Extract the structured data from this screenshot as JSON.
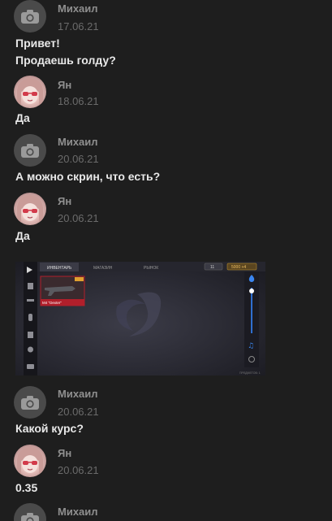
{
  "messages": [
    {
      "author": "Михаил",
      "date": "17.06.21",
      "lines": [
        "Привет!",
        "Продаешь голду?"
      ],
      "avatar": "camera-icon"
    },
    {
      "author": "Ян",
      "date": "18.06.21",
      "lines": [
        "Да"
      ],
      "avatar": "anime-avatar"
    },
    {
      "author": "Михаил",
      "date": "20.06.21",
      "lines": [
        "А можно скрин, что есть?"
      ],
      "avatar": "camera-icon"
    },
    {
      "author": "Ян",
      "date": "20.06.21",
      "lines": [
        "Да"
      ],
      "avatar": "anime-avatar",
      "attachment": "screenshot"
    },
    {
      "author": "Михаил",
      "date": "20.06.21",
      "lines": [
        "Какой курс?"
      ],
      "avatar": "camera-icon"
    },
    {
      "author": "Ян",
      "date": "20.06.21",
      "lines": [
        "0.35"
      ],
      "avatar": "anime-avatar"
    },
    {
      "author": "Михаил",
      "date": "",
      "lines": [],
      "avatar": "camera-icon"
    }
  ],
  "attachment_screenshot": {
    "tabs": [
      "ИНВЕНТАРЬ",
      "МАГАЗИН",
      "РЫНОК"
    ],
    "item_label": "M4 \"Dexter\"",
    "currency_a": "11",
    "currency_b": "5000 +4",
    "footer": "ПРЕДМЕТОВ: 1"
  },
  "colors": {
    "background": "#1e1e1e",
    "name": "#8f8f8f",
    "date": "#6b6b6b",
    "text": "#e8e8e8",
    "avatar_default": "#4a4a4a"
  }
}
